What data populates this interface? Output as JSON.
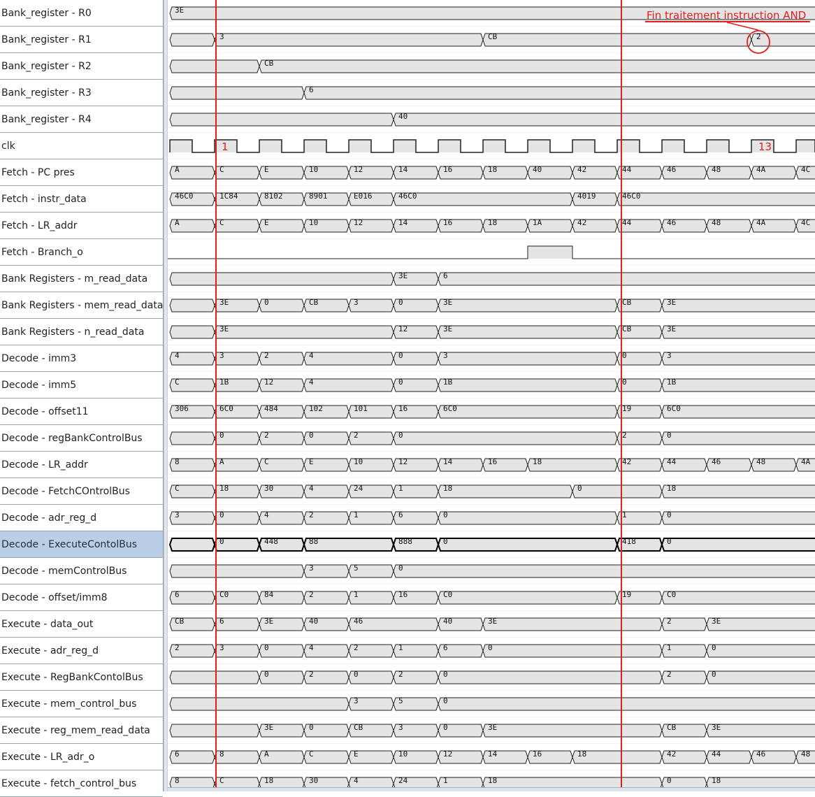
{
  "period": 64,
  "signals": [
    {
      "name": "Bank_register - R0",
      "type": "bus",
      "segments": [
        [
          0,
          "3E"
        ]
      ]
    },
    {
      "name": "Bank_register - R1",
      "type": "bus",
      "segments": [
        [
          0,
          ""
        ],
        [
          64,
          "3"
        ],
        [
          448,
          "CB"
        ],
        [
          832,
          "2"
        ]
      ]
    },
    {
      "name": "Bank_register - R2",
      "type": "bus",
      "segments": [
        [
          0,
          ""
        ],
        [
          128,
          "CB"
        ]
      ]
    },
    {
      "name": "Bank_register - R3",
      "type": "bus",
      "segments": [
        [
          0,
          ""
        ],
        [
          192,
          "6"
        ]
      ]
    },
    {
      "name": "Bank_register - R4",
      "type": "bus",
      "segments": [
        [
          0,
          ""
        ],
        [
          320,
          "40"
        ]
      ]
    },
    {
      "name": "clk",
      "type": "clock"
    },
    {
      "name": "Fetch - PC pres",
      "type": "bus",
      "segments": [
        [
          0,
          "A"
        ],
        [
          64,
          "C"
        ],
        [
          128,
          "E"
        ],
        [
          192,
          "10"
        ],
        [
          256,
          "12"
        ],
        [
          320,
          "14"
        ],
        [
          384,
          "16"
        ],
        [
          448,
          "18"
        ],
        [
          512,
          "40"
        ],
        [
          576,
          "42"
        ],
        [
          640,
          "44"
        ],
        [
          704,
          "46"
        ],
        [
          768,
          "48"
        ],
        [
          832,
          "4A"
        ],
        [
          896,
          "4C"
        ]
      ]
    },
    {
      "name": "Fetch - instr_data",
      "type": "bus",
      "segments": [
        [
          0,
          "46C0"
        ],
        [
          64,
          "1C84"
        ],
        [
          128,
          "8102"
        ],
        [
          192,
          "8901"
        ],
        [
          256,
          "E016"
        ],
        [
          320,
          "46C0"
        ],
        [
          576,
          "4019"
        ],
        [
          640,
          "46C0"
        ]
      ]
    },
    {
      "name": "Fetch - LR_addr",
      "type": "bus",
      "segments": [
        [
          0,
          "A"
        ],
        [
          64,
          "C"
        ],
        [
          128,
          "E"
        ],
        [
          192,
          "10"
        ],
        [
          256,
          "12"
        ],
        [
          320,
          "14"
        ],
        [
          384,
          "16"
        ],
        [
          448,
          "18"
        ],
        [
          512,
          "1A"
        ],
        [
          576,
          "42"
        ],
        [
          640,
          "44"
        ],
        [
          704,
          "46"
        ],
        [
          768,
          "48"
        ],
        [
          832,
          "4A"
        ],
        [
          896,
          "4C"
        ]
      ]
    },
    {
      "name": "Fetch - Branch_o",
      "type": "bit",
      "high": [
        [
          512,
          576
        ]
      ]
    },
    {
      "name": "Bank Registers - m_read_data",
      "type": "bus",
      "segments": [
        [
          0,
          ""
        ],
        [
          320,
          "3E"
        ],
        [
          384,
          "6"
        ]
      ]
    },
    {
      "name": "Bank Registers - mem_read_data",
      "type": "bus",
      "segments": [
        [
          0,
          ""
        ],
        [
          64,
          "3E"
        ],
        [
          128,
          "0"
        ],
        [
          192,
          "CB"
        ],
        [
          256,
          "3"
        ],
        [
          320,
          "0"
        ],
        [
          384,
          "3E"
        ],
        [
          640,
          "CB"
        ],
        [
          704,
          "3E"
        ]
      ]
    },
    {
      "name": "Bank Registers - n_read_data",
      "type": "bus",
      "segments": [
        [
          0,
          ""
        ],
        [
          64,
          "3E"
        ],
        [
          320,
          "12"
        ],
        [
          384,
          "3E"
        ],
        [
          640,
          "CB"
        ],
        [
          704,
          "3E"
        ]
      ]
    },
    {
      "name": "Decode - imm3",
      "type": "bus",
      "segments": [
        [
          0,
          "4"
        ],
        [
          64,
          "3"
        ],
        [
          128,
          "2"
        ],
        [
          192,
          "4"
        ],
        [
          320,
          "0"
        ],
        [
          384,
          "3"
        ],
        [
          640,
          "0"
        ],
        [
          704,
          "3"
        ]
      ]
    },
    {
      "name": "Decode - imm5",
      "type": "bus",
      "segments": [
        [
          0,
          "C"
        ],
        [
          64,
          "1B"
        ],
        [
          128,
          "12"
        ],
        [
          192,
          "4"
        ],
        [
          320,
          "0"
        ],
        [
          384,
          "1B"
        ],
        [
          640,
          "0"
        ],
        [
          704,
          "1B"
        ]
      ]
    },
    {
      "name": "Decode - offset11",
      "type": "bus",
      "segments": [
        [
          0,
          "306"
        ],
        [
          64,
          "6C0"
        ],
        [
          128,
          "484"
        ],
        [
          192,
          "102"
        ],
        [
          256,
          "101"
        ],
        [
          320,
          "16"
        ],
        [
          384,
          "6C0"
        ],
        [
          640,
          "19"
        ],
        [
          704,
          "6C0"
        ]
      ]
    },
    {
      "name": "Decode - regBankControlBus",
      "type": "bus",
      "segments": [
        [
          0,
          ""
        ],
        [
          64,
          "0"
        ],
        [
          128,
          "2"
        ],
        [
          192,
          "0"
        ],
        [
          256,
          "2"
        ],
        [
          320,
          "0"
        ],
        [
          640,
          "2"
        ],
        [
          704,
          "0"
        ]
      ]
    },
    {
      "name": "Decode - LR_addr",
      "type": "bus",
      "segments": [
        [
          0,
          "8"
        ],
        [
          64,
          "A"
        ],
        [
          128,
          "C"
        ],
        [
          192,
          "E"
        ],
        [
          256,
          "10"
        ],
        [
          320,
          "12"
        ],
        [
          384,
          "14"
        ],
        [
          448,
          "16"
        ],
        [
          512,
          "18"
        ],
        [
          640,
          "42"
        ],
        [
          704,
          "44"
        ],
        [
          768,
          "46"
        ],
        [
          832,
          "48"
        ],
        [
          896,
          "4A"
        ]
      ]
    },
    {
      "name": "Decode - FetchCOntrolBus",
      "type": "bus",
      "segments": [
        [
          0,
          "C"
        ],
        [
          64,
          "18"
        ],
        [
          128,
          "30"
        ],
        [
          192,
          "4"
        ],
        [
          256,
          "24"
        ],
        [
          320,
          "1"
        ],
        [
          384,
          "18"
        ],
        [
          576,
          "0"
        ],
        [
          704,
          "18"
        ]
      ]
    },
    {
      "name": "Decode - adr_reg_d",
      "type": "bus",
      "segments": [
        [
          0,
          "3"
        ],
        [
          64,
          "0"
        ],
        [
          128,
          "4"
        ],
        [
          192,
          "2"
        ],
        [
          256,
          "1"
        ],
        [
          320,
          "6"
        ],
        [
          384,
          "0"
        ],
        [
          640,
          "1"
        ],
        [
          704,
          "0"
        ]
      ]
    },
    {
      "name": "Decode - ExecuteContolBus",
      "type": "bus",
      "selected": true,
      "segments": [
        [
          0,
          ""
        ],
        [
          64,
          "0"
        ],
        [
          128,
          "448"
        ],
        [
          192,
          "88"
        ],
        [
          320,
          "888"
        ],
        [
          384,
          "0"
        ],
        [
          640,
          "418"
        ],
        [
          704,
          "0"
        ]
      ]
    },
    {
      "name": "Decode - memControlBus",
      "type": "bus",
      "segments": [
        [
          0,
          ""
        ],
        [
          192,
          "3"
        ],
        [
          256,
          "5"
        ],
        [
          320,
          "0"
        ]
      ]
    },
    {
      "name": "Decode - offset/imm8",
      "type": "bus",
      "segments": [
        [
          0,
          "6"
        ],
        [
          64,
          "C0"
        ],
        [
          128,
          "84"
        ],
        [
          192,
          "2"
        ],
        [
          256,
          "1"
        ],
        [
          320,
          "16"
        ],
        [
          384,
          "C0"
        ],
        [
          640,
          "19"
        ],
        [
          704,
          "C0"
        ]
      ]
    },
    {
      "name": "Execute - data_out",
      "type": "bus",
      "segments": [
        [
          0,
          "CB"
        ],
        [
          64,
          "6"
        ],
        [
          128,
          "3E"
        ],
        [
          192,
          "40"
        ],
        [
          256,
          "46"
        ],
        [
          384,
          "40"
        ],
        [
          448,
          "3E"
        ],
        [
          704,
          "2"
        ],
        [
          768,
          "3E"
        ]
      ]
    },
    {
      "name": "Execute - adr_reg_d",
      "type": "bus",
      "segments": [
        [
          0,
          "2"
        ],
        [
          64,
          "3"
        ],
        [
          128,
          "0"
        ],
        [
          192,
          "4"
        ],
        [
          256,
          "2"
        ],
        [
          320,
          "1"
        ],
        [
          384,
          "6"
        ],
        [
          448,
          "0"
        ],
        [
          704,
          "1"
        ],
        [
          768,
          "0"
        ]
      ]
    },
    {
      "name": "Execute - RegBankContolBus",
      "type": "bus",
      "segments": [
        [
          0,
          ""
        ],
        [
          128,
          "0"
        ],
        [
          192,
          "2"
        ],
        [
          256,
          "0"
        ],
        [
          320,
          "2"
        ],
        [
          384,
          "0"
        ],
        [
          704,
          "2"
        ],
        [
          768,
          "0"
        ]
      ]
    },
    {
      "name": "Execute - mem_control_bus",
      "type": "bus",
      "segments": [
        [
          0,
          ""
        ],
        [
          256,
          "3"
        ],
        [
          320,
          "5"
        ],
        [
          384,
          "0"
        ]
      ]
    },
    {
      "name": "Execute - reg_mem_read_data",
      "type": "bus",
      "segments": [
        [
          0,
          ""
        ],
        [
          128,
          "3E"
        ],
        [
          192,
          "0"
        ],
        [
          256,
          "CB"
        ],
        [
          320,
          "3"
        ],
        [
          384,
          "0"
        ],
        [
          448,
          "3E"
        ],
        [
          704,
          "CB"
        ],
        [
          768,
          "3E"
        ]
      ]
    },
    {
      "name": "Execute - LR_adr_o",
      "type": "bus",
      "segments": [
        [
          0,
          "6"
        ],
        [
          64,
          "8"
        ],
        [
          128,
          "A"
        ],
        [
          192,
          "C"
        ],
        [
          256,
          "E"
        ],
        [
          320,
          "10"
        ],
        [
          384,
          "12"
        ],
        [
          448,
          "14"
        ],
        [
          512,
          "16"
        ],
        [
          576,
          "18"
        ],
        [
          704,
          "42"
        ],
        [
          768,
          "44"
        ],
        [
          832,
          "46"
        ],
        [
          896,
          "48"
        ]
      ]
    },
    {
      "name": "Execute - fetch_control_bus",
      "type": "bus",
      "segments": [
        [
          0,
          "8"
        ],
        [
          64,
          "C"
        ],
        [
          128,
          "18"
        ],
        [
          192,
          "30"
        ],
        [
          256,
          "4"
        ],
        [
          320,
          "24"
        ],
        [
          384,
          "1"
        ],
        [
          448,
          "18"
        ],
        [
          704,
          "0"
        ],
        [
          768,
          "18"
        ]
      ]
    }
  ],
  "markers": [
    {
      "t": 64,
      "label": "1"
    },
    {
      "t": 644,
      "label": ""
    }
  ],
  "clk_labels": [
    {
      "t": 64,
      "label": "1"
    },
    {
      "t": 832,
      "label": "13"
    }
  ],
  "annotation": {
    "text": "Fin traitement instruction AND"
  },
  "colors": {
    "marker": "#e02020",
    "wave": "#222222",
    "fill": "#e4e4e4",
    "bold_wave": "#000000"
  }
}
